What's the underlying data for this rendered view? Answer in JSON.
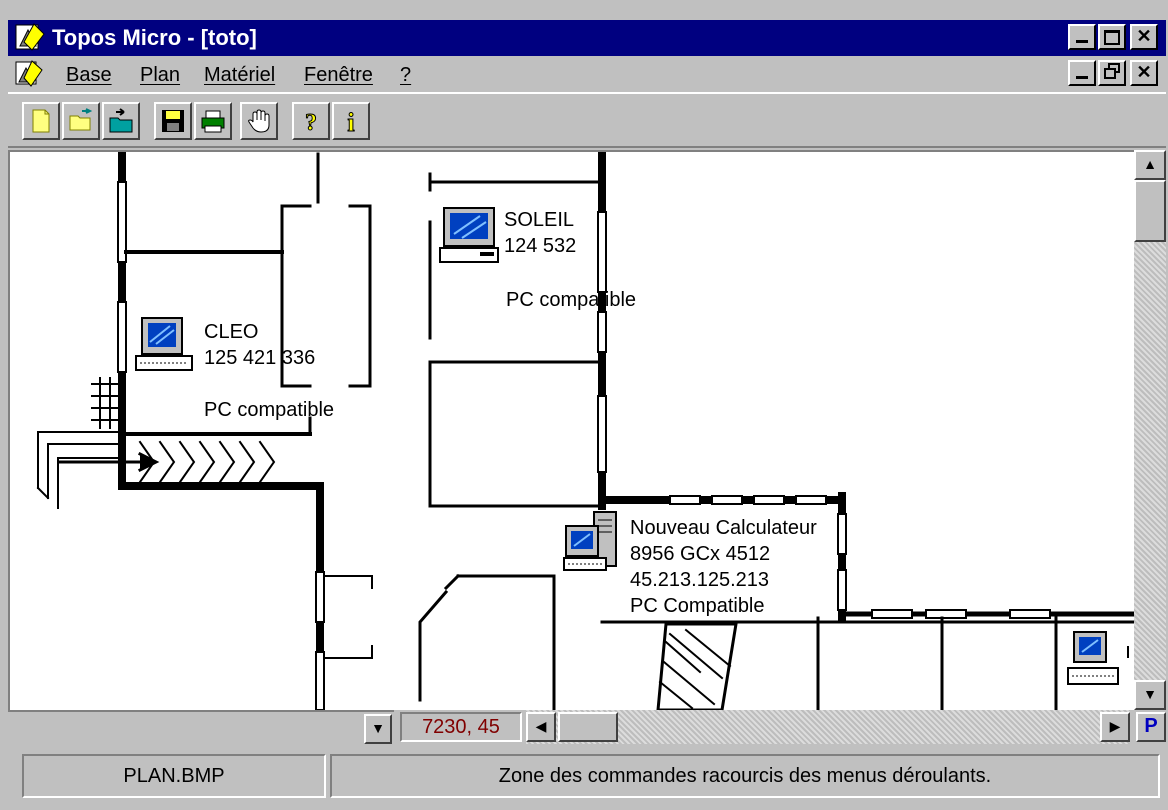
{
  "window": {
    "title": "Topos Micro - [toto]"
  },
  "menubar": {
    "items": [
      {
        "label": "Base",
        "underline": "B"
      },
      {
        "label": "Plan",
        "underline": "P"
      },
      {
        "label": "Matériel",
        "underline": "M"
      },
      {
        "label": "Fenêtre",
        "underline": "F"
      },
      {
        "label": "?",
        "underline": "?"
      }
    ]
  },
  "toolbar": {
    "buttons": [
      "new-icon",
      "open-icon",
      "open-folder-icon",
      "save-icon",
      "print-icon",
      "hand-icon",
      "help-icon",
      "info-icon"
    ]
  },
  "plan": {
    "computers": [
      {
        "name": "SOLEIL",
        "id": "124 532",
        "type": "PC compatible"
      },
      {
        "name": "CLEO",
        "id": "125 421 336",
        "type": "PC compatible"
      },
      {
        "name": "Nouveau Calculateur",
        "id": "8956 GCx 4512",
        "address": "45.213.125.213",
        "type": "PC Compatible"
      }
    ]
  },
  "coordinates": "7230, 45",
  "page_button": "P",
  "statusbar": {
    "file": "PLAN.BMP",
    "message": "Zone des commandes racourcis des menus déroulants."
  },
  "colors": {
    "titlebar": "#000080",
    "coordinates": "#800000",
    "page_button": "#0000c0"
  }
}
